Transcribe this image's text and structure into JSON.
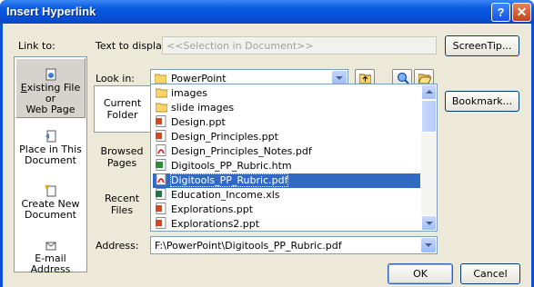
{
  "window": {
    "title": "Insert Hyperlink",
    "help_glyph": "?",
    "close_glyph": "✕"
  },
  "link_to": {
    "label": "Link to:",
    "items": [
      {
        "label_line1": "Existing File or",
        "label_line2": "Web Page",
        "icon": "web-page-icon",
        "selected": true
      },
      {
        "label_line1": "Place in This",
        "label_line2": "Document",
        "icon": "document-place-icon"
      },
      {
        "label_line1": "Create New",
        "label_line2": "Document",
        "icon": "new-document-icon"
      },
      {
        "label_line1": "E-mail Address",
        "label_line2": "",
        "icon": "email-icon"
      }
    ]
  },
  "text_to_display": {
    "label": "Text to display:",
    "value": "<<Selection in Document>>"
  },
  "screentip_label": "ScreenTip...",
  "look_in": {
    "label": "Look in:",
    "value": "PowerPoint"
  },
  "bookmark_label": "Bookmark...",
  "tabs": [
    {
      "line1": "Current",
      "line2": "Folder",
      "selected": true
    },
    {
      "line1": "Browsed",
      "line2": "Pages"
    },
    {
      "line1": "Recent",
      "line2": "Files"
    }
  ],
  "files": [
    {
      "name": "images",
      "icon": "folder-icon"
    },
    {
      "name": "slide images",
      "icon": "folder-icon"
    },
    {
      "name": "Design.ppt",
      "icon": "ppt-icon"
    },
    {
      "name": "Design_Principles.ppt",
      "icon": "ppt-icon"
    },
    {
      "name": "Design_Principles_Notes.pdf",
      "icon": "pdf-icon"
    },
    {
      "name": "Digitools_PP_Rubric.htm",
      "icon": "htm-icon"
    },
    {
      "name": "Digitools_PP_Rubric.pdf",
      "icon": "pdf-icon",
      "selected": true
    },
    {
      "name": "Education_Income.xls",
      "icon": "xls-icon"
    },
    {
      "name": "Explorations.ppt",
      "icon": "ppt-icon"
    },
    {
      "name": "Explorations2.ppt",
      "icon": "ppt-icon"
    }
  ],
  "address": {
    "label": "Address:",
    "value": "F:\\PowerPoint\\Digitools_PP_Rubric.pdf"
  },
  "ok_label": "OK",
  "cancel_label": "Cancel",
  "colors": {
    "titlebar": "#0a5ae0",
    "face": "#ece9d8",
    "selection": "#316ac5",
    "field_border": "#7f9db9"
  }
}
